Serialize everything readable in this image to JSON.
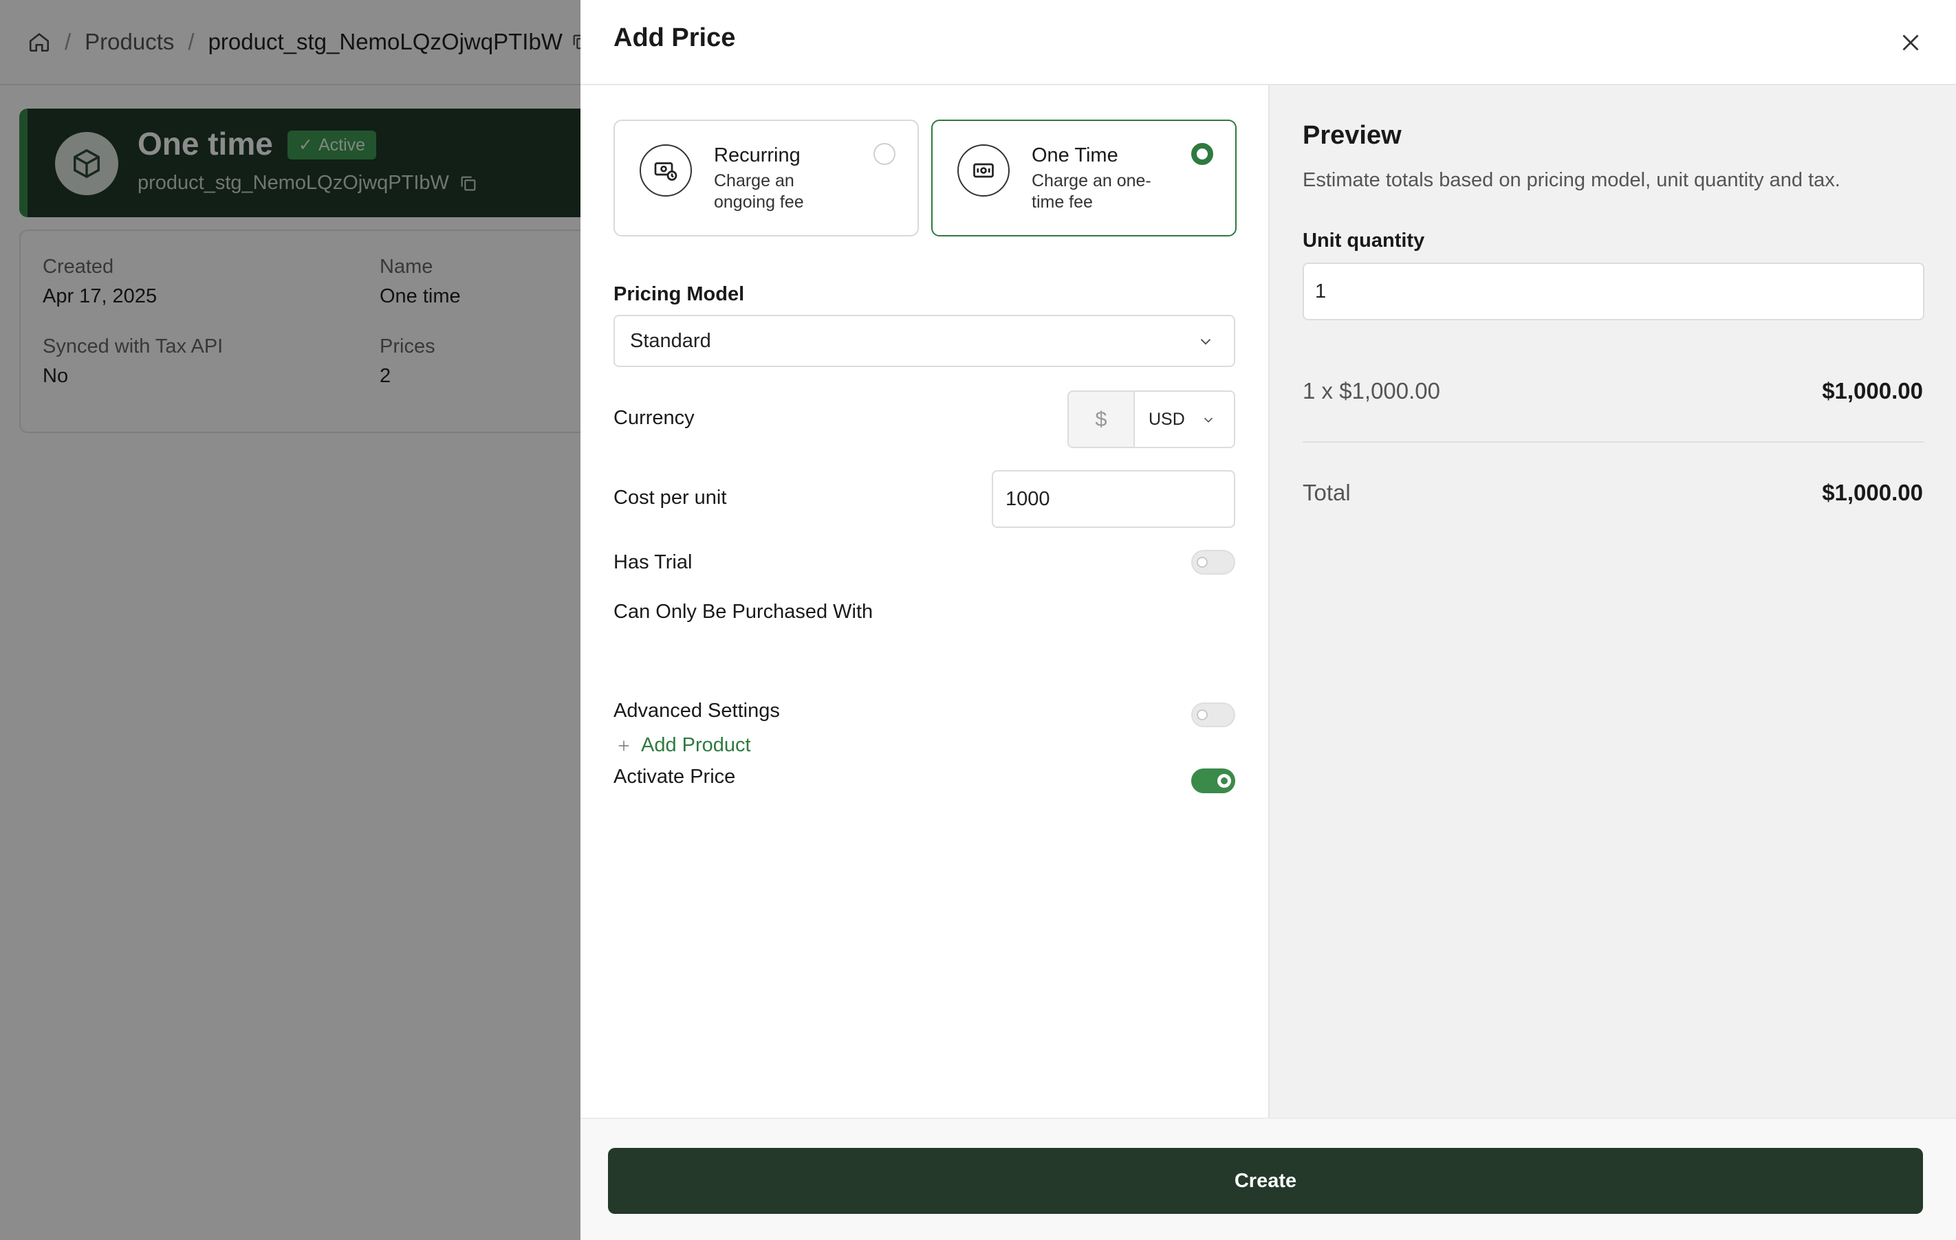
{
  "breadcrumb": {
    "items": [
      "Products",
      "product_stg_NemoLQzOjwqPTIbW"
    ]
  },
  "product": {
    "title": "One time",
    "status": "Active",
    "id": "product_stg_NemoLQzOjwqPTIbW",
    "details": [
      {
        "label": "Created",
        "value": "Apr 17, 2025"
      },
      {
        "label": "Name",
        "value": "One time"
      },
      {
        "label": "Synced with Tax API",
        "value": "No"
      },
      {
        "label": "Prices",
        "value": "2"
      }
    ]
  },
  "drawer": {
    "title": "Add Price",
    "price_types": [
      {
        "title": "Recurring",
        "description": "Charge an ongoing fee",
        "selected": false,
        "icon": "recurring-money-icon"
      },
      {
        "title": "One Time",
        "description": "Charge an one-time fee",
        "selected": true,
        "icon": "cash-icon"
      }
    ],
    "pricing_model": {
      "label": "Pricing Model",
      "value": "Standard"
    },
    "currency": {
      "label": "Currency",
      "symbol": "$",
      "value": "USD"
    },
    "cost_per_unit": {
      "label": "Cost per unit",
      "value": "1000"
    },
    "has_trial": {
      "label": "Has Trial",
      "enabled": false
    },
    "purchased_with": {
      "label": "Can Only Be Purchased With",
      "add_label": "Add Product"
    },
    "advanced_settings": {
      "label": "Advanced Settings",
      "enabled": false
    },
    "activate_price": {
      "label": "Activate Price",
      "enabled": true
    },
    "create_label": "Create"
  },
  "preview": {
    "title": "Preview",
    "description": "Estimate totals based on pricing model, unit quantity and tax.",
    "quantity_label": "Unit quantity",
    "quantity": "1",
    "line_item": "1 x $1,000.00",
    "line_amount": "$1,000.00",
    "total_label": "Total",
    "total_amount": "$1,000.00"
  },
  "colors": {
    "accent": "#2f7a40",
    "primary_button": "#24392a",
    "hero_bg": "#1f3a2a"
  }
}
